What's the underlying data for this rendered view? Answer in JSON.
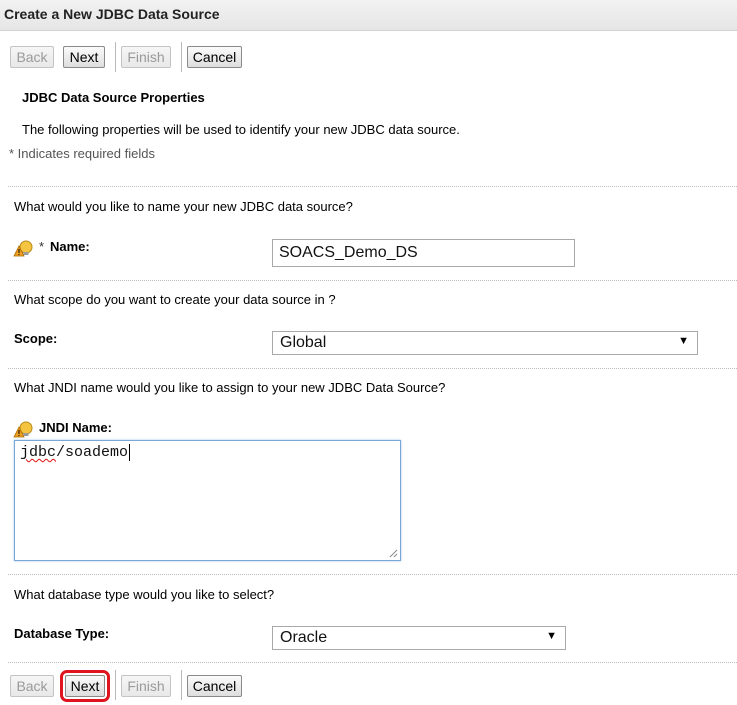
{
  "header": {
    "title": "Create a New JDBC Data Source"
  },
  "nav": {
    "back": "Back",
    "next": "Next",
    "finish": "Finish",
    "cancel": "Cancel"
  },
  "section": {
    "title": "JDBC Data Source Properties",
    "description": "The following properties will be used to identify your new JDBC data source.",
    "required_note": "* Indicates required fields"
  },
  "name_field": {
    "question": "What would you like to name your new JDBC data source?",
    "required_marker": "*",
    "label": "Name:",
    "value": "SOACS_Demo_DS"
  },
  "scope_field": {
    "question": "What scope do you want to create your data source in ?",
    "label": "Scope:",
    "value": "Global"
  },
  "jndi_field": {
    "question": "What JNDI name would you like to assign to your new JDBC Data Source?",
    "label": "JNDI Name:",
    "value_underlined": "jdbc",
    "value_rest": "/soademo"
  },
  "dbtype_field": {
    "question": "What database type would you like to select?",
    "label": "Database Type:",
    "value": "Oracle"
  },
  "colors": {
    "highlight": "#e0141e",
    "focus_border": "#7aa6d8",
    "required": "#333333"
  },
  "icons": {
    "field_help": "lightbulb-warning-icon",
    "dropdown": "triangle-down-icon"
  }
}
